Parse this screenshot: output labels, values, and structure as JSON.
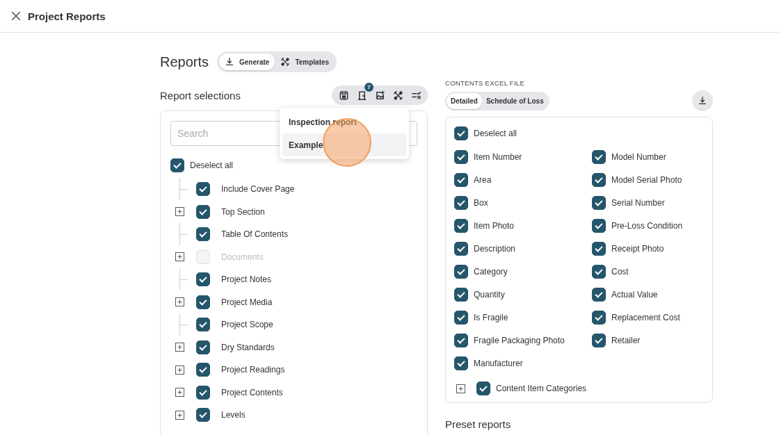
{
  "header": {
    "title": "Project Reports"
  },
  "reports": {
    "title": "Reports",
    "modes": [
      {
        "label": "Generate",
        "selected": true
      },
      {
        "label": "Templates",
        "selected": false
      }
    ]
  },
  "selections": {
    "title": "Report selections",
    "toolbar_badge": "7",
    "search": {
      "placeholder": "Search"
    },
    "deselect_all": {
      "label": "Deselect all",
      "checked": true
    },
    "items": [
      {
        "label": "Include Cover Page",
        "expandable": false,
        "checked": true,
        "disabled": false
      },
      {
        "label": "Top Section",
        "expandable": true,
        "checked": true,
        "disabled": false
      },
      {
        "label": "Table Of Contents",
        "expandable": false,
        "checked": true,
        "disabled": false
      },
      {
        "label": "Documents",
        "expandable": true,
        "checked": false,
        "disabled": true
      },
      {
        "label": "Project Notes",
        "expandable": false,
        "checked": true,
        "disabled": false
      },
      {
        "label": "Project Media",
        "expandable": true,
        "checked": true,
        "disabled": false
      },
      {
        "label": "Project Scope",
        "expandable": false,
        "checked": true,
        "disabled": false
      },
      {
        "label": "Dry Standards",
        "expandable": true,
        "checked": true,
        "disabled": false
      },
      {
        "label": "Project Readings",
        "expandable": true,
        "checked": true,
        "disabled": false
      },
      {
        "label": "Project Contents",
        "expandable": true,
        "checked": true,
        "disabled": false
      },
      {
        "label": "Levels",
        "expandable": true,
        "checked": true,
        "disabled": false
      }
    ]
  },
  "template_menu": {
    "items": [
      {
        "label": "Inspection report",
        "selected": false
      },
      {
        "label": "Example",
        "selected": true
      }
    ]
  },
  "excel": {
    "title": "CONTENTS EXCEL FILE",
    "formats": [
      {
        "label": "Detailed",
        "selected": true
      },
      {
        "label": "Schedule of Loss",
        "selected": false
      }
    ],
    "deselect_all": {
      "label": "Deselect all",
      "checked": true
    },
    "fields": [
      {
        "label": "Item Number",
        "checked": true
      },
      {
        "label": "Model Number",
        "checked": true
      },
      {
        "label": "Area",
        "checked": true
      },
      {
        "label": "Model Serial Photo",
        "checked": true
      },
      {
        "label": "Box",
        "checked": true
      },
      {
        "label": "Serial Number",
        "checked": true
      },
      {
        "label": "Item Photo",
        "checked": true
      },
      {
        "label": "Pre-Loss Condition",
        "checked": true
      },
      {
        "label": "Description",
        "checked": true
      },
      {
        "label": "Receipt Photo",
        "checked": true
      },
      {
        "label": "Category",
        "checked": true
      },
      {
        "label": "Cost",
        "checked": true
      },
      {
        "label": "Quantity",
        "checked": true
      },
      {
        "label": "Actual Value",
        "checked": true
      },
      {
        "label": "Is Fragile",
        "checked": true
      },
      {
        "label": "Replacement Cost",
        "checked": true
      },
      {
        "label": "Fragile Packaging Photo",
        "checked": true
      },
      {
        "label": "Retailer",
        "checked": true
      },
      {
        "label": "Manufacturer",
        "checked": true
      }
    ],
    "categories": {
      "label": "Content Item Categories",
      "checked": true,
      "expandable": true
    }
  },
  "preset": {
    "title": "Preset reports"
  }
}
